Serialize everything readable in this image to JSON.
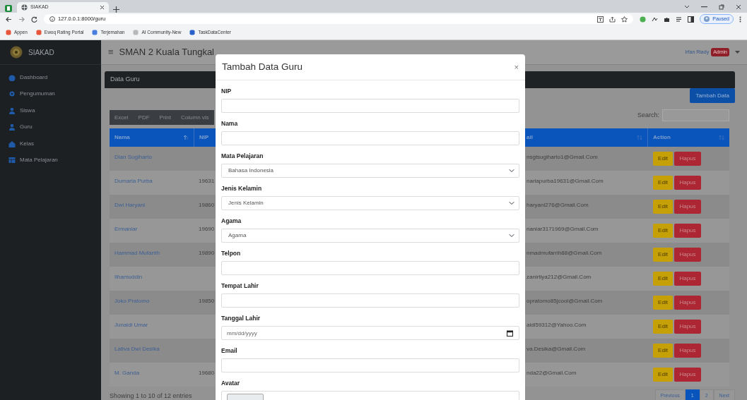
{
  "browser": {
    "tab_title": "SIAKAD",
    "url": "127.0.0.1:8000/guru",
    "profile_button": "Paused",
    "bookmarks": [
      {
        "label": "Appen",
        "color": "#e8553a"
      },
      {
        "label": "Ewoq Rating Portal",
        "color": "#e8553a"
      },
      {
        "label": "Terjemahan",
        "color": "#4a7fe0"
      },
      {
        "label": "AI Community-New",
        "color": "#b8b8b8"
      },
      {
        "label": "TaskDataCenter",
        "color": "#2a62c9"
      }
    ]
  },
  "sidebar": {
    "brand": "SIAKAD",
    "items": [
      {
        "label": "Dashboard"
      },
      {
        "label": "Pengumuman"
      },
      {
        "label": "Siswa"
      },
      {
        "label": "Guru"
      },
      {
        "label": "Kelas"
      },
      {
        "label": "Mata Pelajaran"
      }
    ]
  },
  "header": {
    "menu_icon": "≡",
    "title": "SMAN 2 Kuala Tungkal",
    "user": "Irfan Riady",
    "role_badge": "Admin"
  },
  "card": {
    "title": "Data Guru",
    "add_button": "Tambah Data",
    "toolbar": [
      "Excel",
      "PDF",
      "Print",
      "Column vis"
    ],
    "search_label": "Search:"
  },
  "table": {
    "columns": [
      {
        "label": "Nama",
        "sorted": true
      },
      {
        "label": "NIP",
        "sorted": false
      },
      {
        "label": "ail",
        "sorted": false
      },
      {
        "label": "Action",
        "sorted": false
      }
    ],
    "rows": [
      {
        "nama": "Dian Sugiharto",
        "nip": "",
        "email": "nsgtsugiharto1@Gmail.Com",
        "actions": [
          "Edit",
          "Hapus"
        ]
      },
      {
        "nama": "Dumaria Purba",
        "nip": "19631",
        "email": "nariapurba19631@Gmail.Com",
        "actions": [
          "Edit",
          "Hapus"
        ]
      },
      {
        "nama": "Dwi Haryani",
        "nip": "19860",
        "email": "haryani276@Gmail.Com",
        "actions": [
          "Edit",
          "Hapus"
        ]
      },
      {
        "nama": "Ermaniar",
        "nip": "19690",
        "email": "naniar3171969@Gmail.Com",
        "actions": [
          "Edit",
          "Hapus"
        ]
      },
      {
        "nama": "Hammad Mufarrih",
        "nip": "19890",
        "email": "nmadmufarrih88@Gmail.Com",
        "actions": [
          "Edit",
          "Hapus"
        ]
      },
      {
        "nama": "Ilhamuddin",
        "nip": "",
        "email": "zanirtiya212@Gmail.Com",
        "actions": [
          "Edit",
          "Hapus"
        ]
      },
      {
        "nama": "Joko Pratomo",
        "nip": "19850",
        "email": "opratomo85jcool@Gmail.Com",
        "actions": [
          "Edit",
          "Hapus"
        ]
      },
      {
        "nama": "Junaidi Umar",
        "nip": "",
        "email": "aidi59312@Yahoo.Com",
        "actions": [
          "Edit",
          "Hapus"
        ]
      },
      {
        "nama": "Lativa Dwi Desika",
        "nip": "",
        "email": "va.Desika@Gmail.Com",
        "actions": [
          "Edit",
          "Hapus"
        ]
      },
      {
        "nama": "M. Ganda",
        "nip": "19680",
        "email": "nda22@Gmail.Com",
        "actions": [
          "Edit",
          "Hapus"
        ]
      }
    ]
  },
  "footer": {
    "info": "Showing 1 to 10 of 12 entries",
    "pagination": [
      {
        "label": "Previous",
        "selected": false
      },
      {
        "label": "1",
        "selected": true
      },
      {
        "label": "2",
        "selected": false
      },
      {
        "label": "Next",
        "selected": false
      }
    ]
  },
  "modal": {
    "title": "Tambah Data Guru",
    "close": "×",
    "fields": [
      {
        "label": "NIP",
        "kind": "text"
      },
      {
        "label": "Nama",
        "kind": "text"
      },
      {
        "label": "Mata Pelajaran",
        "kind": "select",
        "value": "Bahasa Indonesia"
      },
      {
        "label": "Jenis Kelamin",
        "kind": "select",
        "value": "Jenis Kelamin"
      },
      {
        "label": "Agama",
        "kind": "select",
        "value": "Agama"
      },
      {
        "label": "Telpon",
        "kind": "text"
      },
      {
        "label": "Tempat Lahir",
        "kind": "text"
      },
      {
        "label": "Tanggal Lahir",
        "kind": "date",
        "placeholder": "mm/dd/yyyy"
      },
      {
        "label": "Email",
        "kind": "text"
      },
      {
        "label": "Avatar",
        "kind": "file"
      }
    ]
  }
}
